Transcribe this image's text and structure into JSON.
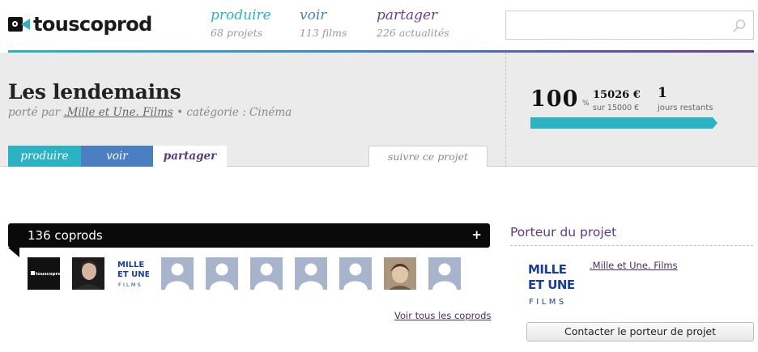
{
  "brand": {
    "logo_text": "touscoprod"
  },
  "nav": [
    {
      "title": "produire",
      "subtitle": "68 projets",
      "color": "#2bb3c4"
    },
    {
      "title": "voir",
      "subtitle": "113 films",
      "color": "#4a7fc1"
    },
    {
      "title": "partager",
      "subtitle": "226 actualités",
      "color": "#6a3f8f"
    }
  ],
  "search": {
    "value": "",
    "placeholder": "",
    "icon": "search-icon"
  },
  "project": {
    "title": "Les lendemains",
    "meta_prefix": "porté par ",
    "owner_link": ".Mille et Une. Films",
    "meta_suffix": " • catégorie : Cinéma",
    "tabs": [
      {
        "label": "produire",
        "color": "#2bb3c4"
      },
      {
        "label": "voir",
        "color": "#4a7fc1"
      },
      {
        "label": "partager",
        "active": true
      }
    ],
    "follow_label": "suivre ce projet"
  },
  "funding": {
    "percent": "100",
    "percent_sign": "%",
    "raised": "15026 €",
    "goal": "sur 15000 €",
    "days_left": "1",
    "days_label": "jours restants",
    "progress": 1.0,
    "progress_color": "#2bb3c4"
  },
  "coprods": {
    "title": "136 coprods",
    "plus": "+",
    "see_all": "Voir tous les coprods",
    "avatars": [
      {
        "kind": "touscoprod-logo",
        "logo_text": "touscoprod"
      },
      {
        "kind": "photo-man"
      },
      {
        "kind": "mille-logo",
        "lines": [
          "MILLE",
          "ET UNE",
          "FILMS"
        ]
      },
      {
        "kind": "default"
      },
      {
        "kind": "default"
      },
      {
        "kind": "default"
      },
      {
        "kind": "default"
      },
      {
        "kind": "default"
      },
      {
        "kind": "photo-child"
      },
      {
        "kind": "default"
      }
    ]
  },
  "porteur": {
    "title": "Porteur du projet",
    "logo_lines": [
      "MILLE",
      "ET UNE",
      "FILMS"
    ],
    "name": ".Mille et Une. Films",
    "contact_label": "Contacter le porteur de projet"
  }
}
